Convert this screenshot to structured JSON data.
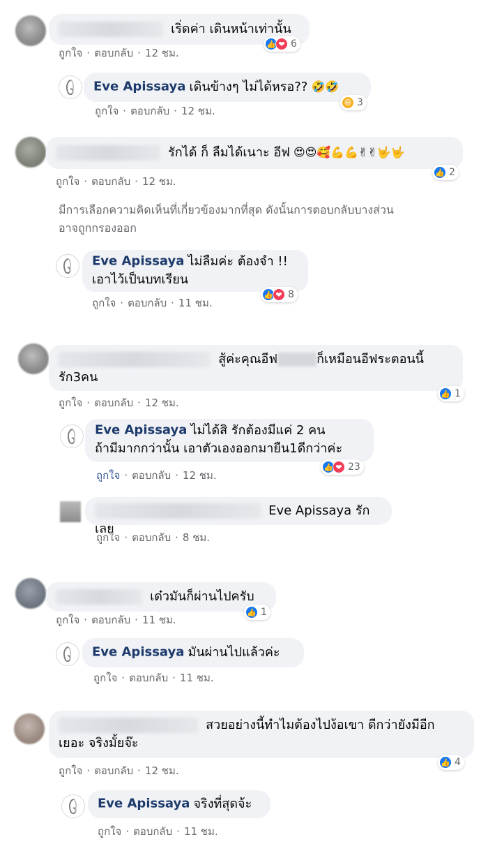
{
  "actions": {
    "like": "ถูกใจ",
    "reply": "ตอบกลับ",
    "sep": "·"
  },
  "threads": [
    {
      "comment": {
        "text": "เริ่ดค่า เดินหน้าเท่านั้น",
        "time": "12 ชม.",
        "reactions": "6"
      },
      "replies": [
        {
          "author": "Eve Apissaya",
          "text": "เดินข้างๆ ไม่ได้หรอ??",
          "emoji": "🤣🤣",
          "time": "12 ชม.",
          "reactions": "3"
        }
      ]
    },
    {
      "comment": {
        "text": "รักได้ ก็ ลืมได้เนาะ อีฟ",
        "emoji": "😍😍🥰💪💪✌✌🤟🤟",
        "time": "12 ชม.",
        "reactions": "2"
      },
      "notice": [
        "มีการเลือกความคิดเห็นที่เกี่ยวข้องมากที่สุด ดังนั้นการตอบกลับบางส่วน",
        "อาจถูกกรองออก"
      ],
      "replies": [
        {
          "author": "Eve Apissaya",
          "text": "ไม่ลืมค่ะ ต้องจำ !!",
          "text2": "เอาไว้เป็นบทเรียน",
          "time": "11 ชม.",
          "reactions": "8"
        }
      ]
    },
    {
      "comment": {
        "text_a": "สู้ค่ะคุณอีฟ",
        "text_b": "ก็เหมือนอีฟระตอนนี้",
        "text2": "รัก3คน",
        "time": "12 ชม.",
        "reactions": "1"
      },
      "replies": [
        {
          "author": "Eve Apissaya",
          "text": "ไม่ได้สิ รักต้องมีแค่ 2 คน",
          "text2": "ถ้ามีมากกว่านั้น เอาตัวเองออกมายืน1ดีกว่าค่ะ",
          "time": "12 ชม.",
          "reactions": "23"
        },
        {
          "text": "Eve Apissaya รักเลย",
          "time": "8 ชม."
        }
      ]
    },
    {
      "comment": {
        "text": "เด๋วมันก็ผ่านไปครับ",
        "time": "11 ชม.",
        "reactions": "1"
      },
      "replies": [
        {
          "author": "Eve Apissaya",
          "text": "มันผ่านไปแล้วค่ะ",
          "time": "11 ชม."
        }
      ]
    },
    {
      "comment": {
        "text": "สวยอย่างนี้ทำไมต้องไปง้อเขา ดีกว่ายังมีอีก",
        "text2": "เยอะ จริงมั้ยจ๊ะ",
        "time": "12 ชม.",
        "reactions": "4"
      },
      "replies": [
        {
          "author": "Eve Apissaya",
          "text": "จริงที่สุดจ้ะ",
          "time": "11 ชม."
        }
      ]
    }
  ]
}
